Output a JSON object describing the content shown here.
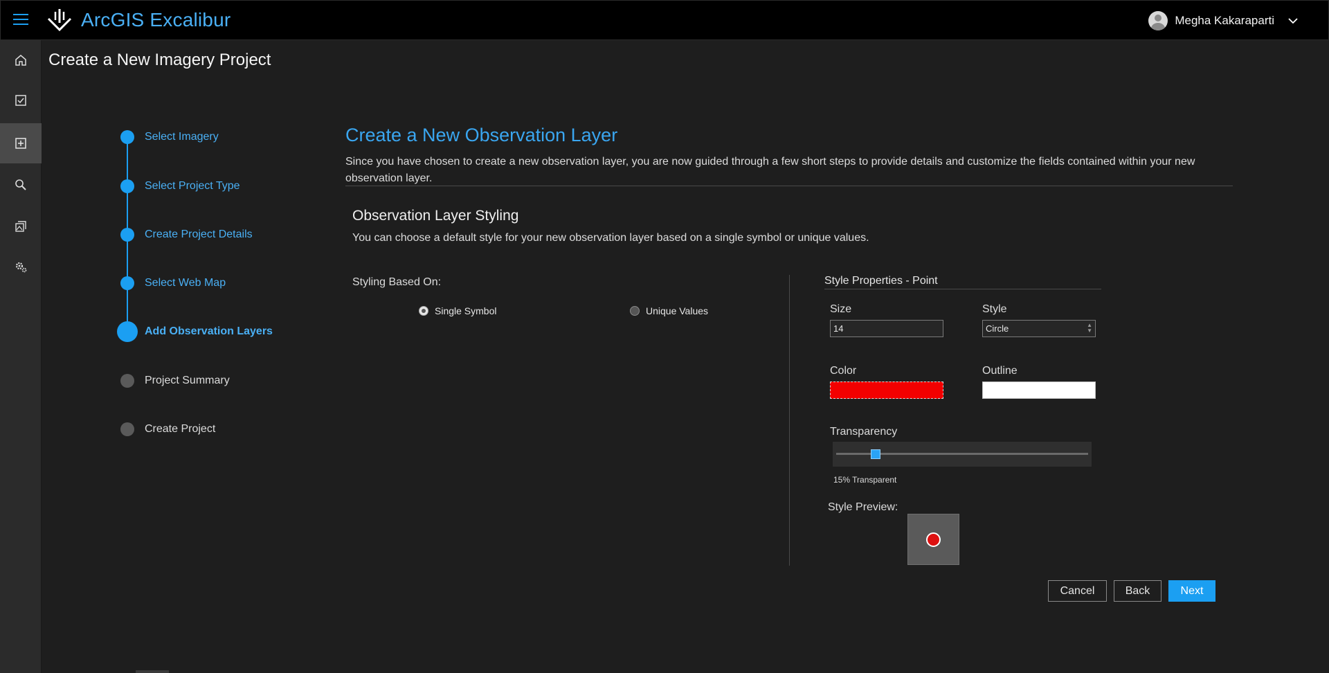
{
  "header": {
    "app_title": "ArcGIS Excalibur",
    "user_name": "Megha Kakaraparti",
    "icons": [
      "menu-icon",
      "excalibur-logo-icon",
      "user-avatar-icon",
      "chevron-down-icon"
    ]
  },
  "sidebar": {
    "items": [
      {
        "name": "home",
        "icon": "home-icon"
      },
      {
        "name": "tasks",
        "icon": "checkbox-icon"
      },
      {
        "name": "create",
        "icon": "add-box-icon",
        "active": true
      },
      {
        "name": "search",
        "icon": "search-icon"
      },
      {
        "name": "images",
        "icon": "image-stack-icon"
      },
      {
        "name": "settings",
        "icon": "gears-icon"
      }
    ]
  },
  "page": {
    "title": "Create a New Imagery Project"
  },
  "stepper": {
    "steps": [
      {
        "label": "Select Imagery",
        "state": "done"
      },
      {
        "label": "Select Project Type",
        "state": "done"
      },
      {
        "label": "Create Project Details",
        "state": "done"
      },
      {
        "label": "Select Web Map",
        "state": "done"
      },
      {
        "label": "Add Observation Layers",
        "state": "current"
      },
      {
        "label": "Project Summary",
        "state": "future"
      },
      {
        "label": "Create Project",
        "state": "future"
      }
    ]
  },
  "main": {
    "section_title": "Create a New Observation Layer",
    "intro": "Since you have chosen to create a new observation layer, you are now guided through a few short steps to provide details and customize the fields contained within your new observation layer.",
    "styling": {
      "title": "Observation Layer Styling",
      "description": "You can choose a default style for your new observation layer based on a single symbol or unique values.",
      "based_on_label": "Styling Based On:",
      "options": [
        {
          "label": "Single Symbol",
          "checked": true
        },
        {
          "label": "Unique Values",
          "checked": false
        }
      ]
    },
    "properties": {
      "title": "Style Properties - Point",
      "size_label": "Size",
      "size_value": "14",
      "style_label": "Style",
      "style_value": "Circle",
      "color_label": "Color",
      "color_value": "#f20000",
      "outline_label": "Outline",
      "outline_value": "#ffffff",
      "transparency_label": "Transparency",
      "transparency_percent": 15,
      "transparency_readout": "15% Transparent",
      "preview_label": "Style Preview:",
      "preview_fill": "#dd1111"
    },
    "buttons": {
      "cancel": "Cancel",
      "back": "Back",
      "next": "Next"
    }
  },
  "colors": {
    "accent": "#1b9ff2",
    "title_blue": "#3aa6f0",
    "background": "#1e1e1e",
    "topbar": "#000000"
  }
}
